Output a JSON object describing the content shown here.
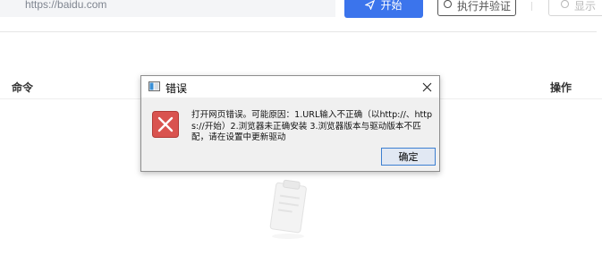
{
  "toolbar": {
    "url_value": "https://baidu.com",
    "start_label": "开始",
    "run_label": "执行并验证",
    "settings_label": "显示"
  },
  "table": {
    "headers": {
      "command": "命令",
      "operations": "操作"
    }
  },
  "dialog": {
    "title": "错误",
    "message": "打开网页错误。可能原因：1.URL输入不正确（以http://、https://开始）2.浏览器未正确安装 3.浏览器版本与驱动版本不匹配，请在设置中更新驱动",
    "ok_label": "确定"
  },
  "colors": {
    "primary": "#3b74ec",
    "error": "#d9534f",
    "ok_button_border": "#3c7fd1"
  }
}
